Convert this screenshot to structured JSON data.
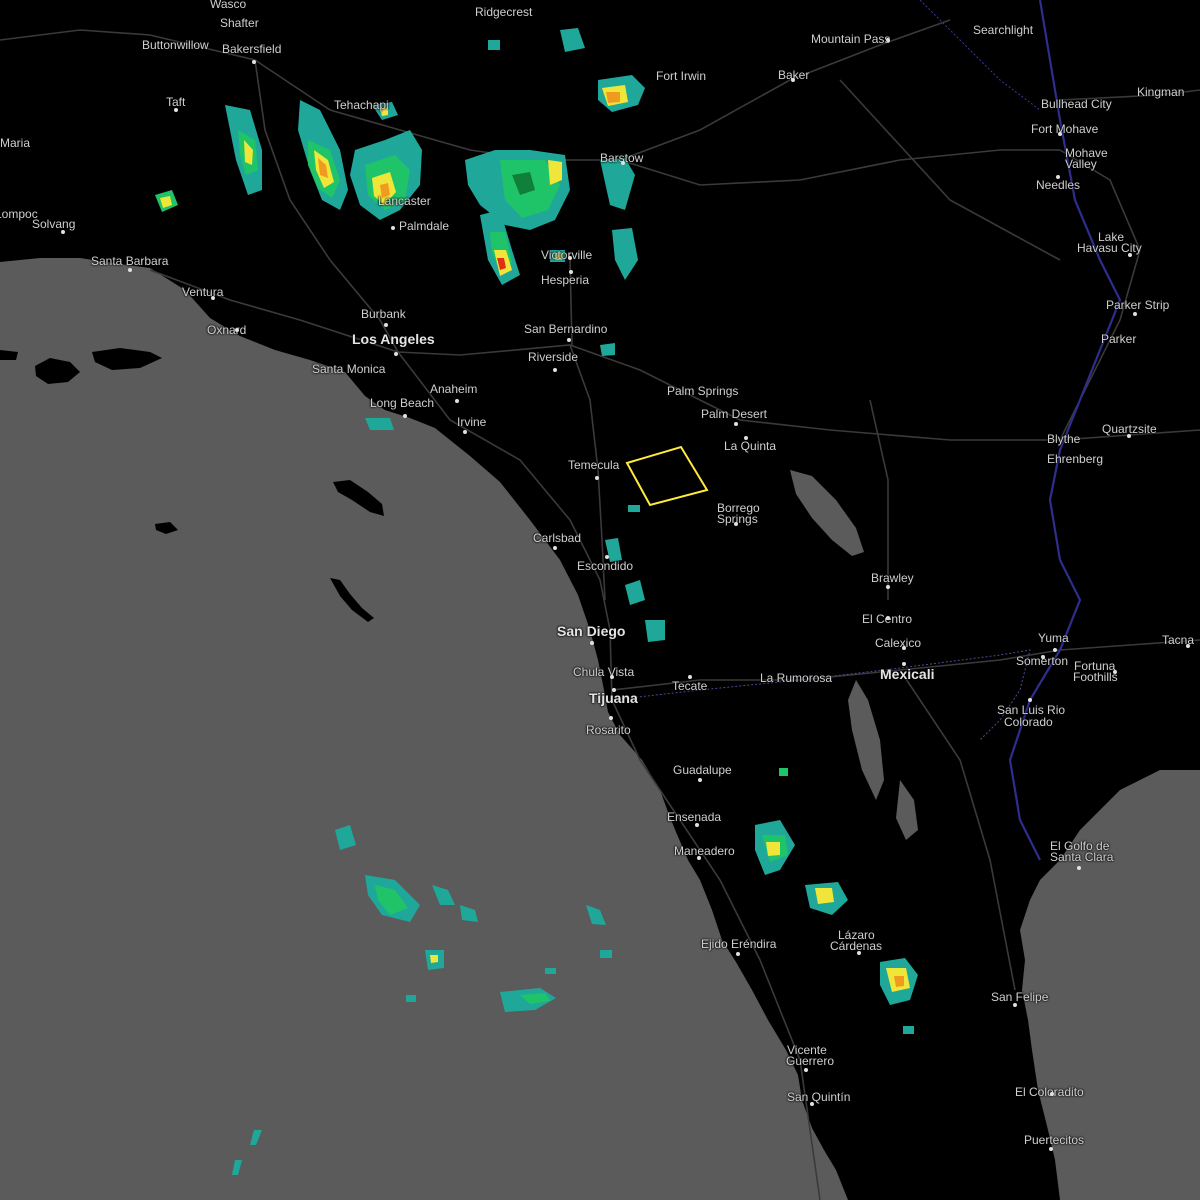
{
  "map": {
    "colors": {
      "land": "#000000",
      "water": "#5b5b5b",
      "roads": "#3a3a3a",
      "border": "#4a4a9a",
      "river": "#2e2e6e",
      "warning_polygon": "#ffeb3b",
      "radar_light": "#1fa89a",
      "radar_green": "#1fc468",
      "radar_dark_green": "#0f7f3a",
      "radar_yellow": "#f0e63a",
      "radar_orange": "#f09a20",
      "radar_red": "#e03018"
    },
    "cities": [
      {
        "name": "Wasco",
        "class": "minor"
      },
      {
        "name": "Shafter",
        "class": "minor"
      },
      {
        "name": "Ridgecrest",
        "class": "minor"
      },
      {
        "name": "Buttonwillow",
        "class": "minor"
      },
      {
        "name": "Bakersfield",
        "class": "mid"
      },
      {
        "name": "Mountain Pass",
        "class": "minor"
      },
      {
        "name": "Searchlight",
        "class": "minor"
      },
      {
        "name": "Fort Irwin",
        "class": "minor"
      },
      {
        "name": "Baker",
        "class": "minor"
      },
      {
        "name": "Kingman",
        "class": "minor"
      },
      {
        "name": "Taft",
        "class": "minor"
      },
      {
        "name": "Tehachapi",
        "class": "minor"
      },
      {
        "name": "Bullhead City",
        "class": "minor"
      },
      {
        "name": "Fort Mohave",
        "class": "minor"
      },
      {
        "name": "Maria",
        "class": "mid"
      },
      {
        "name": "Barstow",
        "class": "minor"
      },
      {
        "name": "Mohave",
        "class": "minor"
      },
      {
        "name": "Valley",
        "class": "minor"
      },
      {
        "name": "Needles",
        "class": "minor"
      },
      {
        "name": "Lancaster",
        "class": "mid"
      },
      {
        "name": "Palmdale",
        "class": "mid"
      },
      {
        "name": "Lompoc",
        "class": "minor"
      },
      {
        "name": "Solvang",
        "class": "minor"
      },
      {
        "name": "Lake",
        "class": "mid"
      },
      {
        "name": "Havasu City",
        "class": "mid"
      },
      {
        "name": "Victorville",
        "class": "mid"
      },
      {
        "name": "Santa Barbara",
        "class": "mid"
      },
      {
        "name": "Hesperia",
        "class": "mid"
      },
      {
        "name": "Ventura",
        "class": "mid"
      },
      {
        "name": "Parker Strip",
        "class": "minor"
      },
      {
        "name": "Oxnard",
        "class": "mid"
      },
      {
        "name": "Burbank",
        "class": "mid"
      },
      {
        "name": "San Bernardino",
        "class": "mid"
      },
      {
        "name": "Parker",
        "class": "minor"
      },
      {
        "name": "Los Angeles",
        "class": "major"
      },
      {
        "name": "Riverside",
        "class": "mid"
      },
      {
        "name": "Santa Monica",
        "class": "mid"
      },
      {
        "name": "Anaheim",
        "class": "mid"
      },
      {
        "name": "Palm Springs",
        "class": "mid"
      },
      {
        "name": "Long Beach",
        "class": "mid"
      },
      {
        "name": "Palm Desert",
        "class": "mid"
      },
      {
        "name": "Irvine",
        "class": "mid"
      },
      {
        "name": "Quartzsite",
        "class": "minor"
      },
      {
        "name": "Blythe",
        "class": "minor"
      },
      {
        "name": "La Quinta",
        "class": "minor"
      },
      {
        "name": "Ehrenberg",
        "class": "minor"
      },
      {
        "name": "Temecula",
        "class": "mid"
      },
      {
        "name": "Borrego",
        "class": "minor"
      },
      {
        "name": "Springs",
        "class": "minor"
      },
      {
        "name": "Carlsbad",
        "class": "mid"
      },
      {
        "name": "Escondido",
        "class": "mid"
      },
      {
        "name": "Brawley",
        "class": "minor"
      },
      {
        "name": "El Centro",
        "class": "minor"
      },
      {
        "name": "San Diego",
        "class": "major"
      },
      {
        "name": "Yuma",
        "class": "mid"
      },
      {
        "name": "Calexico",
        "class": "minor"
      },
      {
        "name": "Tacna",
        "class": "minor"
      },
      {
        "name": "Somerton",
        "class": "minor"
      },
      {
        "name": "Fortuna",
        "class": "minor"
      },
      {
        "name": "Foothills",
        "class": "minor"
      },
      {
        "name": "Chula Vista",
        "class": "mid"
      },
      {
        "name": "La Rumorosa",
        "class": "minor"
      },
      {
        "name": "Mexicali",
        "class": "major"
      },
      {
        "name": "Tecate",
        "class": "minor"
      },
      {
        "name": "Tijuana",
        "class": "major"
      },
      {
        "name": "San Luis Rio",
        "class": "minor"
      },
      {
        "name": "Colorado",
        "class": "minor"
      },
      {
        "name": "Rosarito",
        "class": "minor"
      },
      {
        "name": "Guadalupe",
        "class": "minor"
      },
      {
        "name": "Ensenada",
        "class": "mid"
      },
      {
        "name": "El Golfo de",
        "class": "minor"
      },
      {
        "name": "Santa Clara",
        "class": "minor"
      },
      {
        "name": "Maneadero",
        "class": "minor"
      },
      {
        "name": "Lázaro",
        "class": "minor"
      },
      {
        "name": "Cárdenas",
        "class": "minor"
      },
      {
        "name": "Ejido Eréndira",
        "class": "minor"
      },
      {
        "name": "San Felipe",
        "class": "minor"
      },
      {
        "name": "Vicente",
        "class": "minor"
      },
      {
        "name": "Guerrero",
        "class": "minor"
      },
      {
        "name": "El Coloradito",
        "class": "minor"
      },
      {
        "name": "San Quintín",
        "class": "minor"
      },
      {
        "name": "Puertecitos",
        "class": "minor"
      }
    ]
  }
}
